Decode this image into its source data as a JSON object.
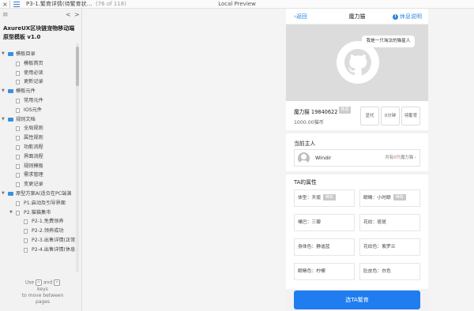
{
  "topbar": {
    "close": "×",
    "title": "P3-1.繁育详情(待繁育状…",
    "count": "(76 of 118)",
    "preview": "Local Preview"
  },
  "sidebar": {
    "header_icon": "≡",
    "prev": "<",
    "next": ">",
    "brand": "AxureUX区块链宠物移动端原型模板 v1.0",
    "tree": [
      {
        "label": "模板目录",
        "type": "folder",
        "level": 0,
        "open": true
      },
      {
        "label": "模板首页",
        "type": "page",
        "level": 1
      },
      {
        "label": "使用必读",
        "type": "page",
        "level": 1
      },
      {
        "label": "更新记录",
        "type": "page",
        "level": 1
      },
      {
        "label": "模板元件",
        "type": "folder",
        "level": 0,
        "open": true
      },
      {
        "label": "常用元件",
        "type": "page",
        "level": 1
      },
      {
        "label": "IOS元件",
        "type": "page",
        "level": 1
      },
      {
        "label": "规则文档",
        "type": "folder",
        "level": 0,
        "open": true
      },
      {
        "label": "全局规则",
        "type": "page",
        "level": 1
      },
      {
        "label": "属性规则",
        "type": "page",
        "level": 1
      },
      {
        "label": "功能流程",
        "type": "page",
        "level": 1
      },
      {
        "label": "界面流程",
        "type": "page",
        "level": 1
      },
      {
        "label": "规则模板",
        "type": "page",
        "level": 1
      },
      {
        "label": "需求管理",
        "type": "page",
        "level": 1
      },
      {
        "label": "变更记录",
        "type": "page",
        "level": 1
      },
      {
        "label": "原型方案A(适合在PC端演",
        "type": "folder",
        "level": 0,
        "open": true
      },
      {
        "label": "P1.启动及引导界面",
        "type": "page",
        "level": 1
      },
      {
        "label": "P2.猫猫集市",
        "type": "page",
        "level": 1,
        "open": true
      },
      {
        "label": "P2-1.免费领养",
        "type": "page",
        "level": 2
      },
      {
        "label": "P2-2.领养成功",
        "type": "page",
        "level": 2
      },
      {
        "label": "P2-3.出售详情(正常",
        "type": "page",
        "level": 2
      },
      {
        "label": "P2-4.出售详情(休息",
        "type": "page",
        "level": 2
      }
    ],
    "hint_use": "Use",
    "hint_left_key": "<",
    "hint_and": "and",
    "hint_right_key": ">",
    "hint_keys": "keys",
    "hint_move": "to move between",
    "hint_pages": "pages"
  },
  "phone": {
    "nav": {
      "back": "返回",
      "back_icon": "‹",
      "title": "魔力猫",
      "help": "休息说明",
      "help_icon": "i"
    },
    "photo": {
      "bubble": "我是一只淘汰的猫星人",
      "logo_icon": "github-cat-icon"
    },
    "info": {
      "name": "魔力猫 19840622",
      "tag": "休息",
      "price": "1000.00猫币",
      "stats": [
        "显代",
        "0分钟",
        "待繁育"
      ]
    },
    "owner": {
      "section_title": "当前主人",
      "name": "Windir",
      "count_prefix": "共有",
      "count_num": "0",
      "count_suffix": "只魔力猫",
      "arrow": "›"
    },
    "attributes": {
      "section_title": "TA的属性",
      "items": [
        {
          "label": "体型：天使",
          "badge": "稀有"
        },
        {
          "label": "眼睛：小时眼",
          "badge": "稀有"
        },
        {
          "label": "嘴巴：三瓣",
          "badge": ""
        },
        {
          "label": "花纹：斑斑",
          "badge": ""
        },
        {
          "label": "身体色：静谧蓝",
          "badge": ""
        },
        {
          "label": "花纹色：紫罗兰",
          "badge": ""
        },
        {
          "label": "眼睛色：柠檬",
          "badge": ""
        },
        {
          "label": "肚皮色：白色",
          "badge": ""
        }
      ]
    },
    "cta": "选TA繁育"
  },
  "colors": {
    "accent": "#1f7df0",
    "folder": "#3d8fe0",
    "highlight": "#e05b3b"
  }
}
